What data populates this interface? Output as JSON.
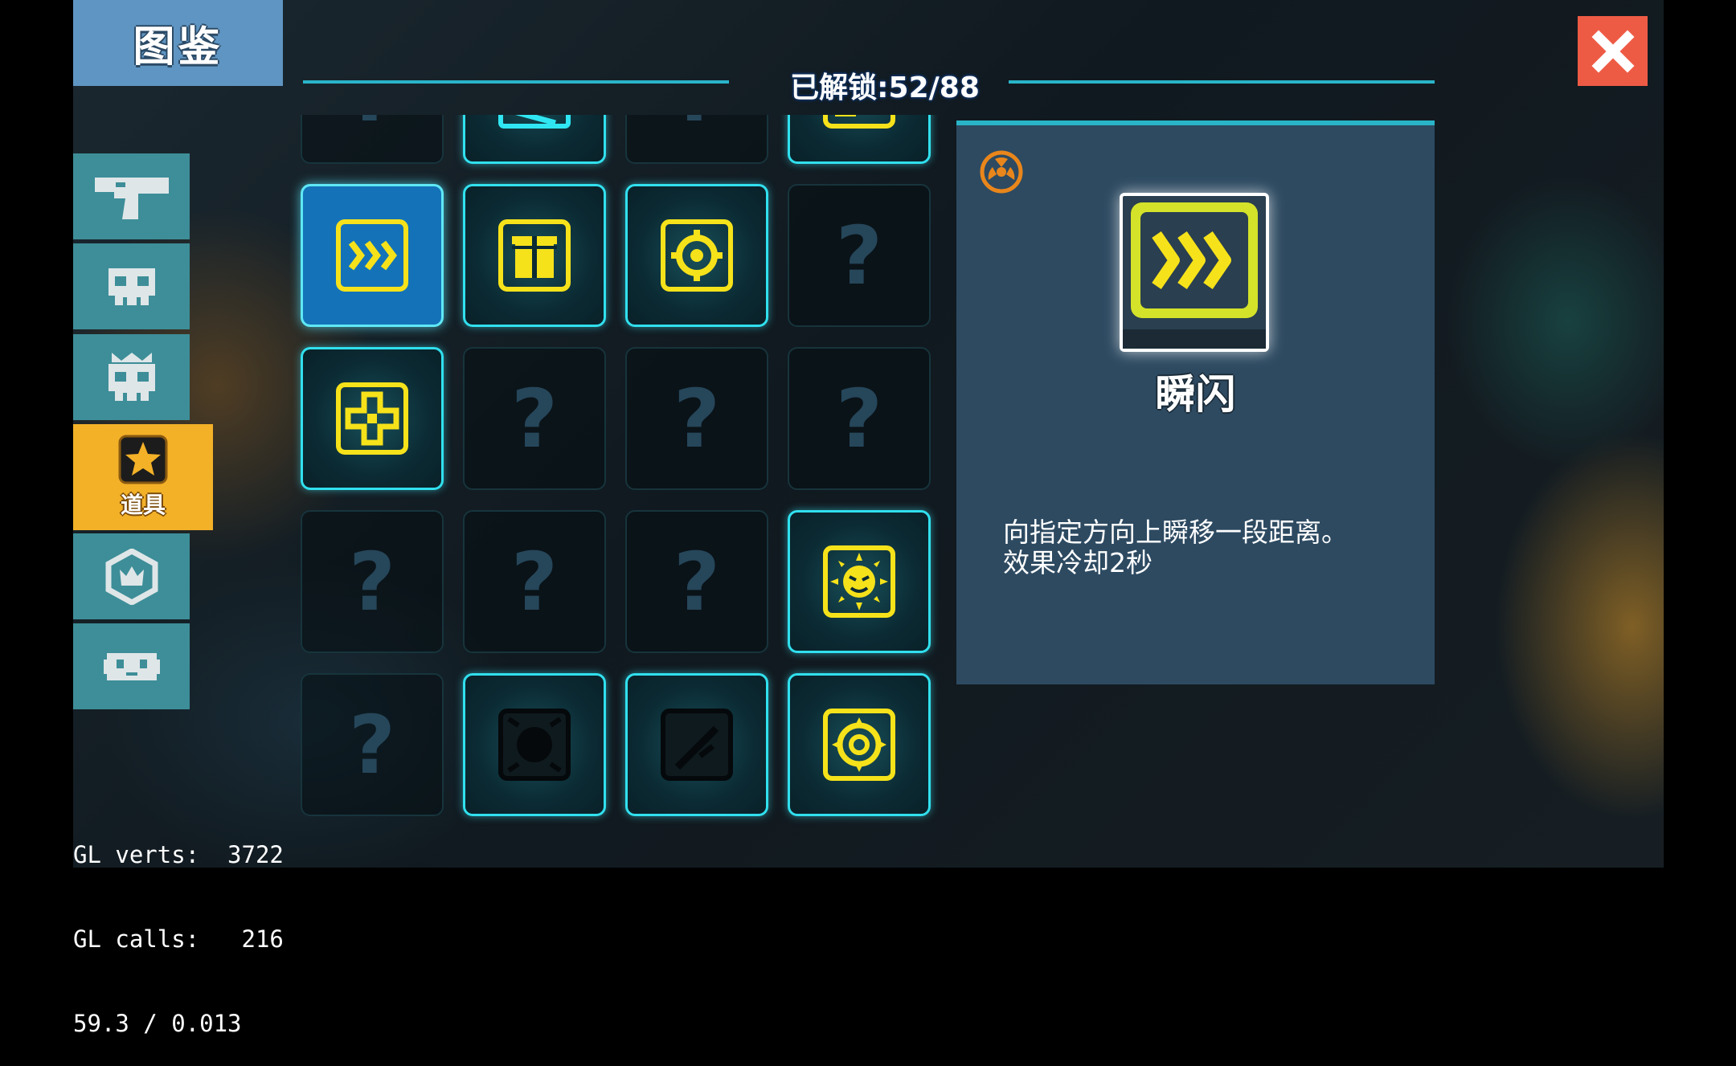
{
  "title": "图鉴",
  "header": {
    "unlocked": "已解锁:52/88"
  },
  "close_icon": "close-x-icon",
  "sidebar": {
    "tabs": [
      {
        "id": "weapons",
        "icon": "pistol-icon",
        "label": ""
      },
      {
        "id": "monsters",
        "icon": "skull-icon",
        "label": ""
      },
      {
        "id": "bosses",
        "icon": "crowned-skull-icon",
        "label": ""
      },
      {
        "id": "items",
        "icon": "star-icon",
        "label": "道具",
        "active": true
      },
      {
        "id": "badges",
        "icon": "crown-hexagon-icon",
        "label": ""
      },
      {
        "id": "pets",
        "icon": "robot-face-icon",
        "label": ""
      }
    ]
  },
  "grid": {
    "cells": [
      {
        "state": "locked",
        "text": "?"
      },
      {
        "state": "unlocked",
        "icon": "jump-figure-icon"
      },
      {
        "state": "locked",
        "text": "?"
      },
      {
        "state": "unlocked",
        "icon": "diagonal-arrows-icon"
      },
      {
        "state": "selected",
        "icon": "dash-chevrons-icon"
      },
      {
        "state": "unlocked",
        "icon": "gift-box-icon"
      },
      {
        "state": "unlocked",
        "icon": "target-gear-icon"
      },
      {
        "state": "locked",
        "text": "?"
      },
      {
        "state": "unlocked",
        "icon": "puzzle-cross-icon"
      },
      {
        "state": "locked",
        "text": "?"
      },
      {
        "state": "locked",
        "text": "?"
      },
      {
        "state": "locked",
        "text": "?"
      },
      {
        "state": "locked",
        "text": "?"
      },
      {
        "state": "locked",
        "text": "?"
      },
      {
        "state": "locked",
        "text": "?"
      },
      {
        "state": "unlocked",
        "icon": "angry-sun-icon"
      },
      {
        "state": "locked",
        "text": "?"
      },
      {
        "state": "unlocked",
        "icon": "dark-orb-icon"
      },
      {
        "state": "unlocked",
        "icon": "dark-slash-icon"
      },
      {
        "state": "unlocked",
        "icon": "spiked-gear-icon"
      }
    ]
  },
  "detail": {
    "badge_icon": "radiation-badge-icon",
    "icon": "dash-chevrons-icon",
    "name": "瞬闪",
    "description": [
      "向指定方向上瞬移一段距离。",
      "效果冷却2秒"
    ]
  },
  "debug": {
    "lines": [
      "GL verts:  3722",
      "GL calls:   216",
      "59.3 / 0.013"
    ]
  },
  "colors": {
    "accent_cyan": "#31e0ee",
    "tab_teal": "#3d8e98",
    "tab_active": "#f3b128",
    "icon_yellow": "#f6e21a",
    "close_red": "#ee5b45",
    "title_blue": "#5f95c2",
    "panel_bg": "#2d4a61"
  }
}
